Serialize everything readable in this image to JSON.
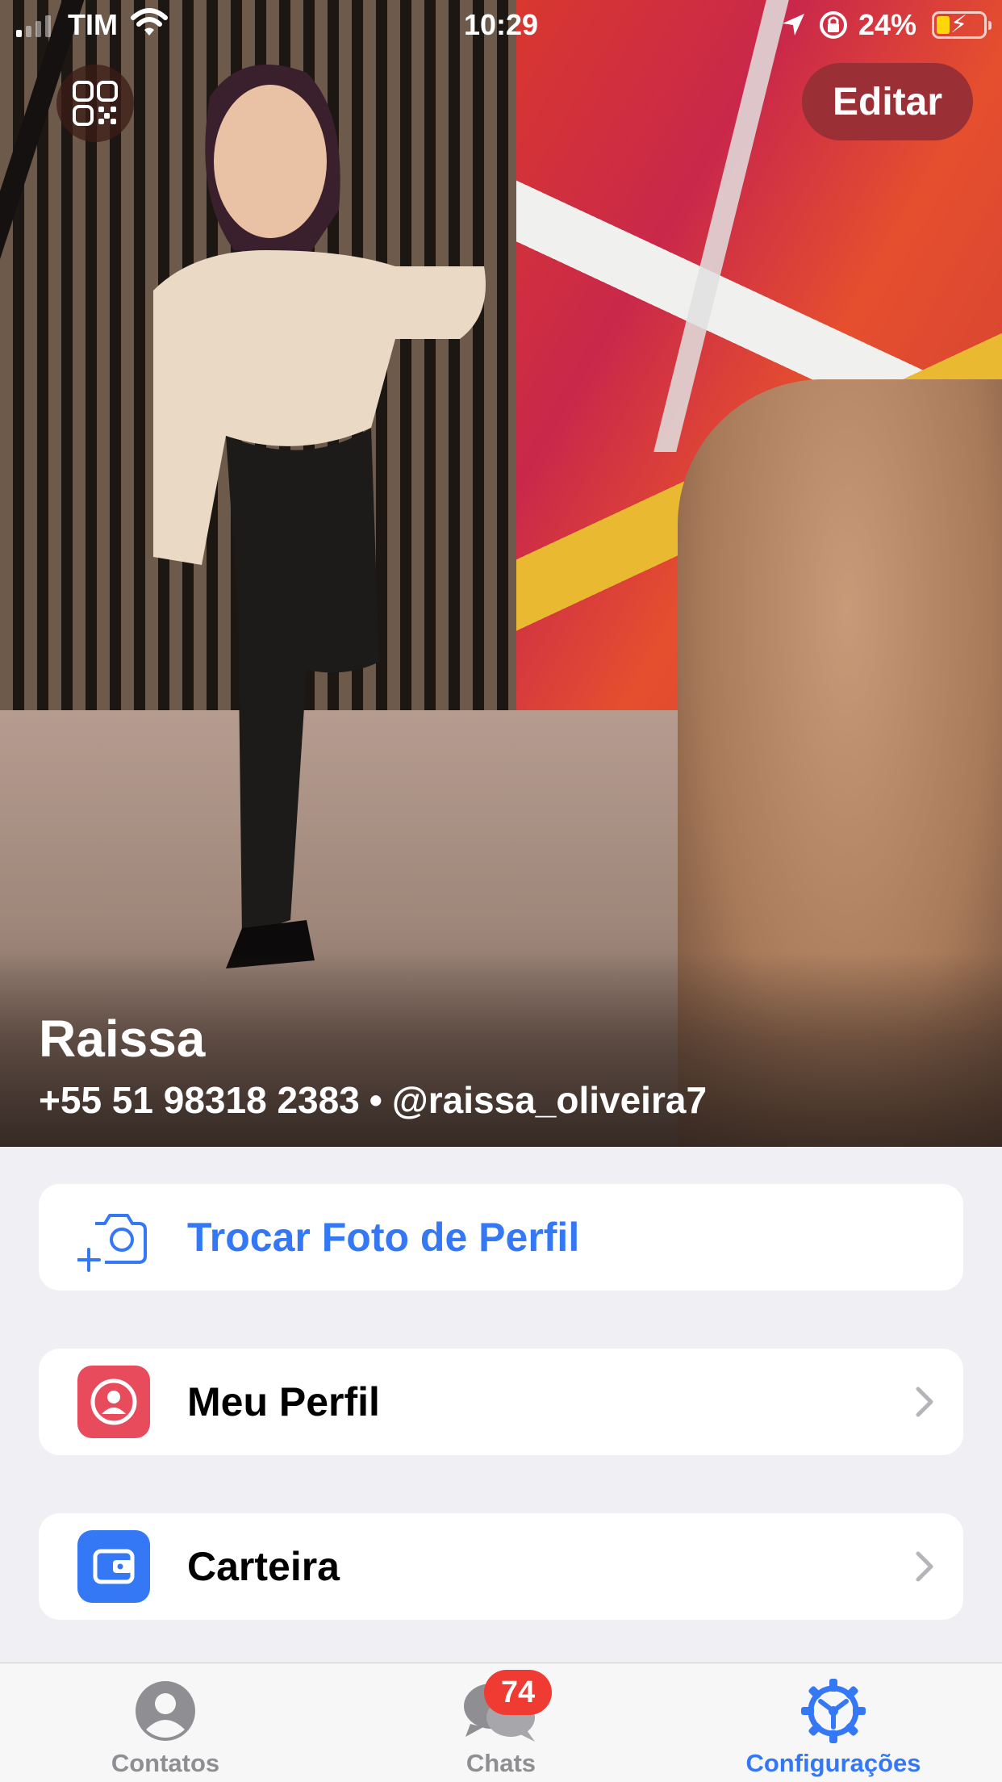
{
  "status_bar": {
    "carrier": "TIM",
    "time": "10:29",
    "battery_percent": "24%",
    "battery_level": 0.24,
    "signal_bars": 1,
    "icons": [
      "wifi-icon",
      "location-arrow-icon",
      "rotation-lock-icon",
      "battery-charging-icon"
    ]
  },
  "header": {
    "edit_label": "Editar",
    "qr_icon": "qr-code-icon"
  },
  "profile": {
    "name": "Raissa",
    "phone": "+55 51 98318 2383",
    "separator": "•",
    "username": "@raissa_oliveira7"
  },
  "actions": {
    "change_photo": {
      "label": "Trocar Foto de Perfil",
      "icon": "add-camera-icon"
    }
  },
  "menu": {
    "items": [
      {
        "label": "Meu Perfil",
        "icon": "profile-icon",
        "color": "#e84b5c"
      },
      {
        "label": "Carteira",
        "icon": "wallet-icon",
        "color": "#3478f6"
      }
    ]
  },
  "tabbar": {
    "tabs": [
      {
        "label": "Contatos",
        "icon": "person-icon",
        "active": false
      },
      {
        "label": "Chats",
        "icon": "chat-bubbles-icon",
        "active": false,
        "badge": "74"
      },
      {
        "label": "Configurações",
        "icon": "settings-gear-icon",
        "active": true
      }
    ]
  },
  "colors": {
    "accent": "#3478f6",
    "edit_button": "#9b2f36",
    "badge": "#ef3b32",
    "background": "#efeff4"
  }
}
